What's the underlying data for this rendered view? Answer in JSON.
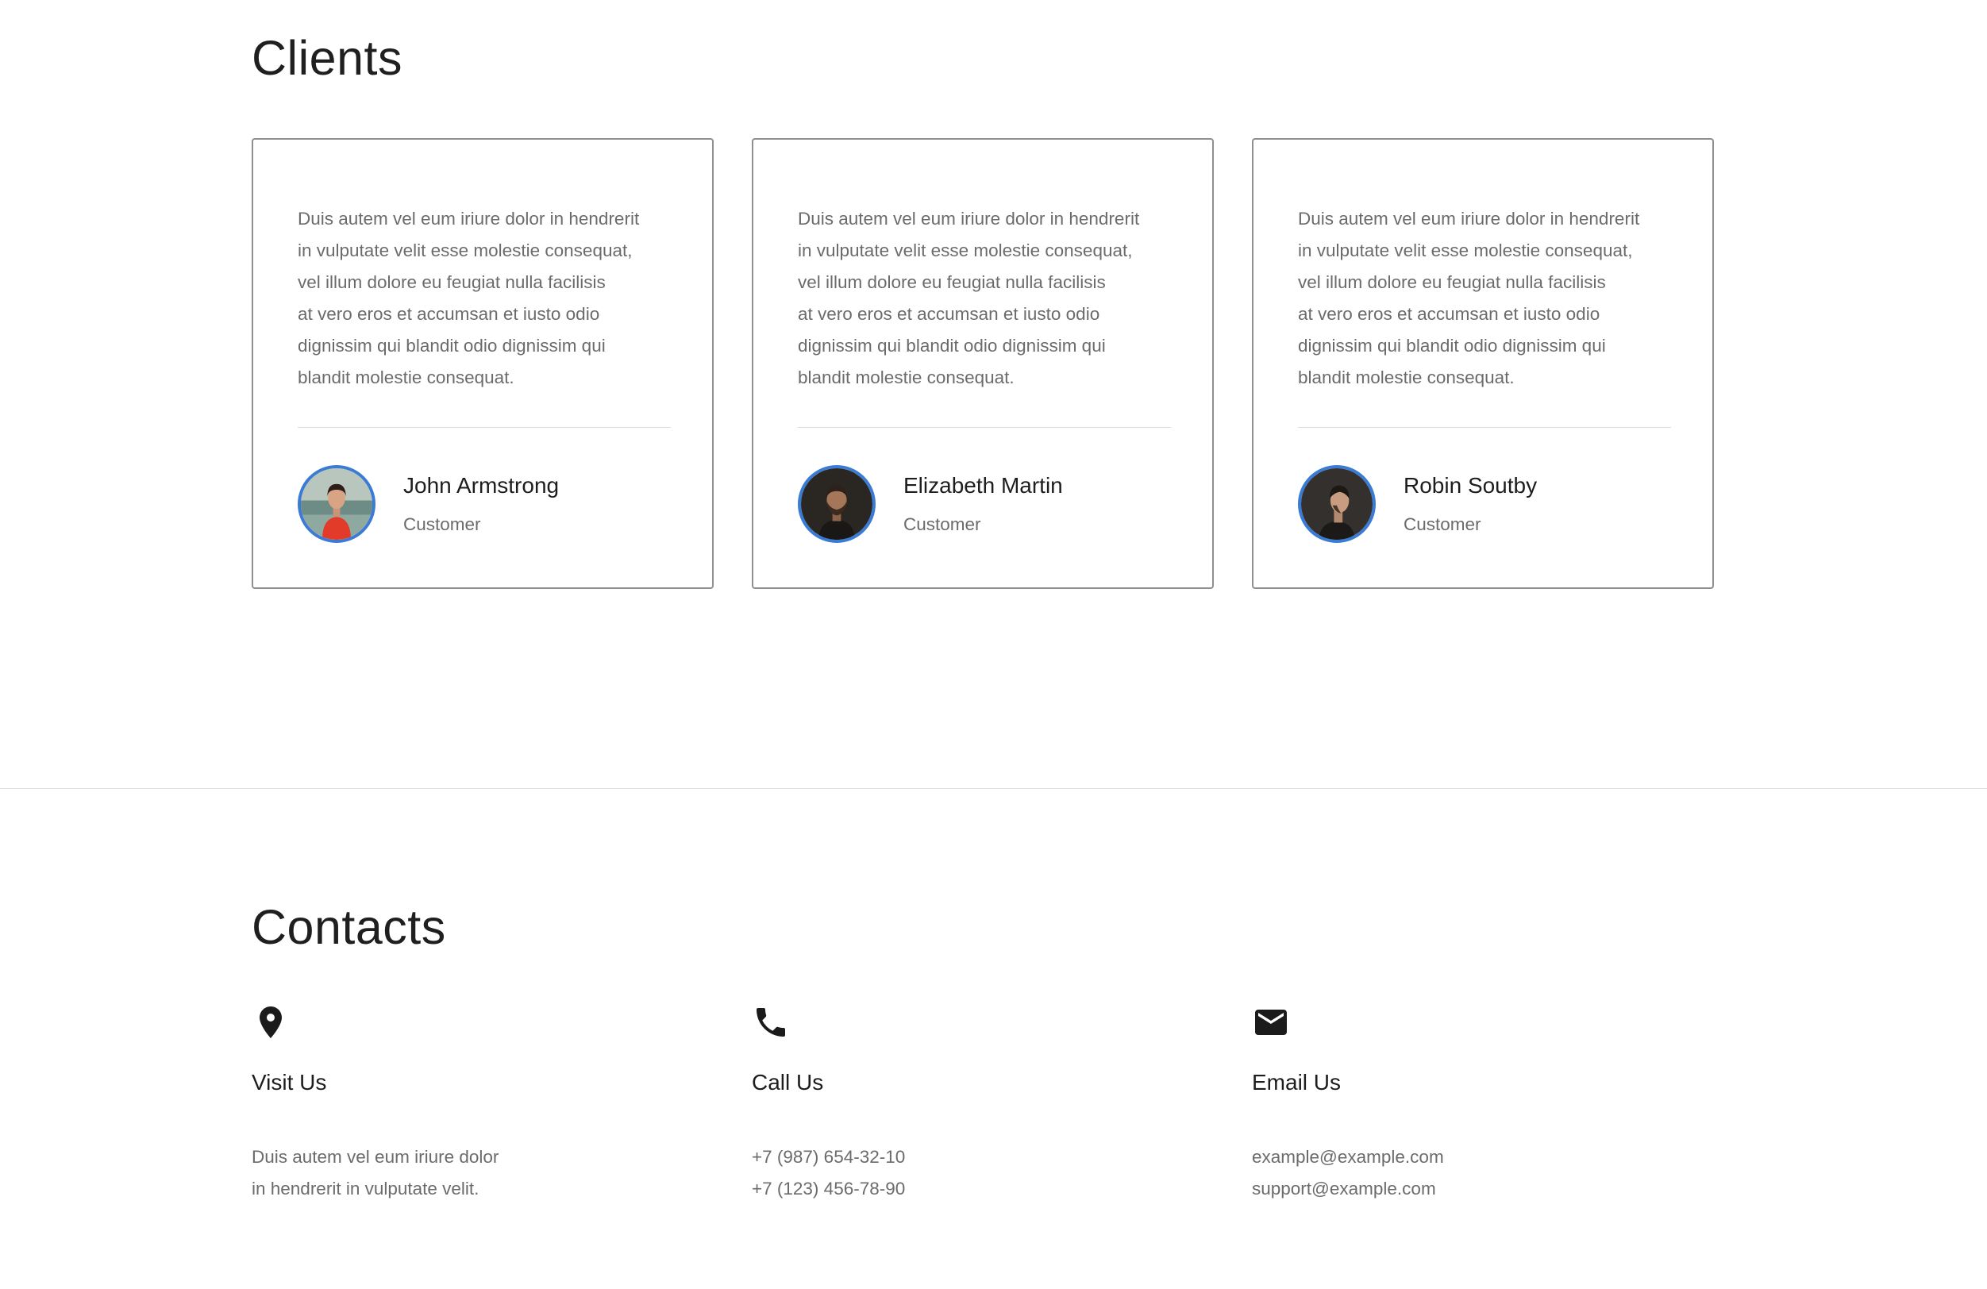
{
  "clients": {
    "title": "Clients",
    "cards": [
      {
        "text_lines": [
          "Duis autem vel eum iriure dolor in hendrerit",
          "in vulputate velit esse molestie consequat,",
          "vel illum dolore eu feugiat nulla facilisis",
          "at vero eros et accumsan et iusto odio",
          "dignissim qui blandit odio dignissim qui",
          "blandit molestie consequat."
        ],
        "name": "John Armstrong",
        "role": "Customer"
      },
      {
        "text_lines": [
          "Duis autem vel eum iriure dolor in hendrerit",
          "in vulputate velit esse molestie consequat,",
          "vel illum dolore eu feugiat nulla facilisis",
          "at vero eros et accumsan et iusto odio",
          "dignissim qui blandit odio dignissim qui",
          "blandit molestie consequat."
        ],
        "name": "Elizabeth Martin",
        "role": "Customer"
      },
      {
        "text_lines": [
          "Duis autem vel eum iriure dolor in hendrerit",
          "in vulputate velit esse molestie consequat,",
          "vel illum dolore eu feugiat nulla facilisis",
          "at vero eros et accumsan et iusto odio",
          "dignissim qui blandit odio dignissim qui",
          "blandit molestie consequat."
        ],
        "name": "Robin Soutby",
        "role": "Customer"
      }
    ]
  },
  "contacts": {
    "title": "Contacts",
    "items": [
      {
        "icon": "map-pin-icon",
        "heading": "Visit Us",
        "lines": [
          "Duis autem vel eum iriure dolor",
          "in hendrerit in vulputate velit."
        ]
      },
      {
        "icon": "phone-icon",
        "heading": "Call Us",
        "lines": [
          "+7 (987) 654-32-10",
          "+7 (123) 456-78-90"
        ]
      },
      {
        "icon": "envelope-icon",
        "heading": "Email Us",
        "lines": [
          "example@example.com",
          "support@example.com"
        ]
      }
    ]
  },
  "colors": {
    "avatar_ring": "#3a7bd5",
    "card_border": "#8f8f8f",
    "body_text": "#6b6b6b",
    "heading_text": "#1d1d1d"
  }
}
